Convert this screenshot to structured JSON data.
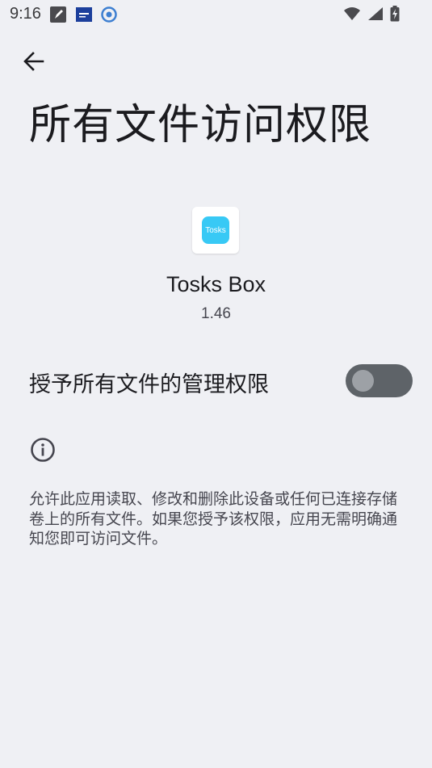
{
  "status_bar": {
    "time": "9:16",
    "left_icons": [
      "edit-note-icon",
      "app-notification-icon",
      "vpn-shield-icon"
    ],
    "right_icons": [
      "wifi-icon",
      "cellular-signal-icon",
      "battery-charging-icon"
    ]
  },
  "header": {
    "back_icon": "arrow-back-icon",
    "title": "所有文件访问权限"
  },
  "app": {
    "icon_text": "Tosks",
    "icon_color": "#38c9f5",
    "name": "Tosks Box",
    "version": "1.46"
  },
  "permission": {
    "label": "授予所有文件的管理权限",
    "enabled": false
  },
  "info": {
    "icon": "info-icon",
    "description": "允许此应用读取、修改和删除此设备或任何已连接存储卷上的所有文件。如果您授予该权限，应用无需明确通知您即可访问文件。"
  },
  "colors": {
    "background": "#eff0f4",
    "toggle_track": "#5e6368",
    "toggle_thumb": "#9da1a6"
  }
}
